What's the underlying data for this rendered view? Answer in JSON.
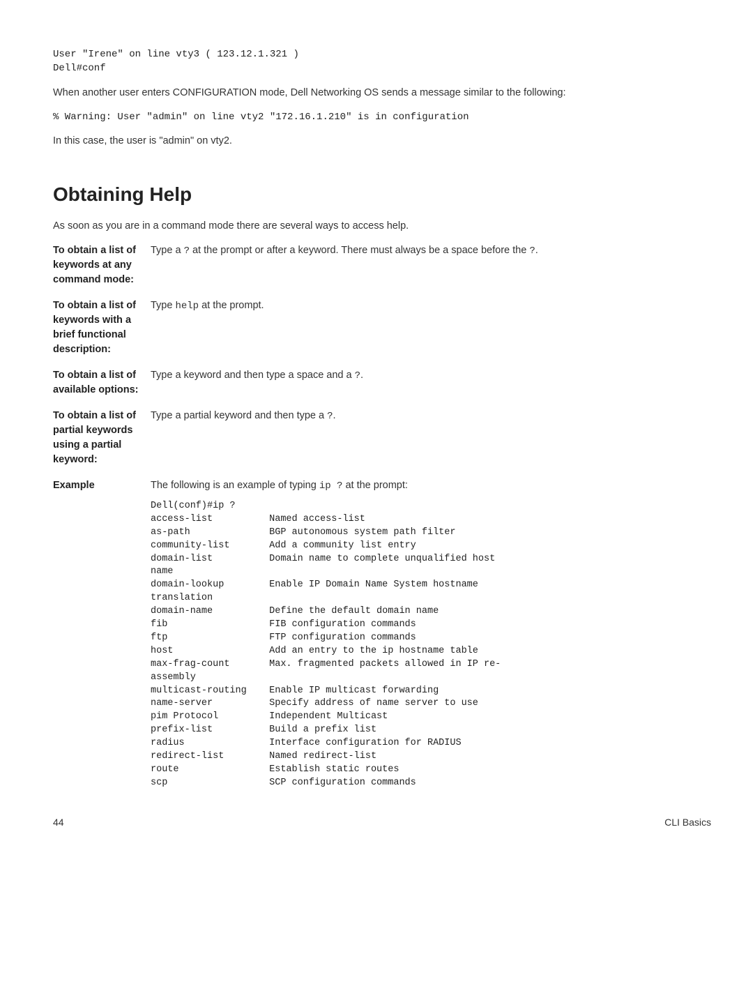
{
  "code1": "User \"Irene\" on line vty3 ( 123.12.1.321 )\nDell#conf",
  "para1": "When another user enters CONFIGURATION mode, Dell Networking OS sends a message similar to the following:",
  "code2": "% Warning: User \"admin\" on line vty2 \"172.16.1.210\" is in configuration",
  "para2": "In this case, the user is \"admin\" on vty2.",
  "heading": "Obtaining Help",
  "intro": "As soon as you are in a command mode there are several ways to access help.",
  "rows": {
    "r1": {
      "term": "To obtain a list of keywords at any command mode:",
      "def_pre": "Type a ",
      "def_mono1": "?",
      "def_mid": " at the prompt or after a keyword. There must always be a space before the ",
      "def_mono2": "?",
      "def_post": "."
    },
    "r2": {
      "term": "To obtain a list of keywords with a brief functional description:",
      "def_pre": "Type ",
      "def_mono": "help",
      "def_post": " at the prompt."
    },
    "r3": {
      "term": "To obtain a list of available options:",
      "def_pre": "Type a keyword and then type a space and a ",
      "def_mono": "?",
      "def_post": "."
    },
    "r4": {
      "term": "To obtain a list of partial keywords using a partial keyword:",
      "def_pre": "Type a partial keyword and then type a ",
      "def_mono": "?",
      "def_post": "."
    },
    "r5": {
      "term": "Example",
      "def_pre": "The following is an example of typing ",
      "def_mono": "ip ?",
      "def_post": " at the prompt:"
    }
  },
  "example_block": "Dell(conf)#ip ?\naccess-list          Named access-list\nas-path              BGP autonomous system path filter\ncommunity-list       Add a community list entry\ndomain-list          Domain name to complete unqualified host \nname\ndomain-lookup        Enable IP Domain Name System hostname \ntranslation\ndomain-name          Define the default domain name\nfib                  FIB configuration commands\nftp                  FTP configuration commands\nhost                 Add an entry to the ip hostname table\nmax-frag-count       Max. fragmented packets allowed in IP re-\nassembly\nmulticast-routing    Enable IP multicast forwarding\nname-server          Specify address of name server to use\npim Protocol         Independent Multicast\nprefix-list          Build a prefix list\nradius               Interface configuration for RADIUS\nredirect-list        Named redirect-list\nroute                Establish static routes\nscp                  SCP configuration commands",
  "footer": {
    "left": "44",
    "right": "CLI Basics"
  }
}
